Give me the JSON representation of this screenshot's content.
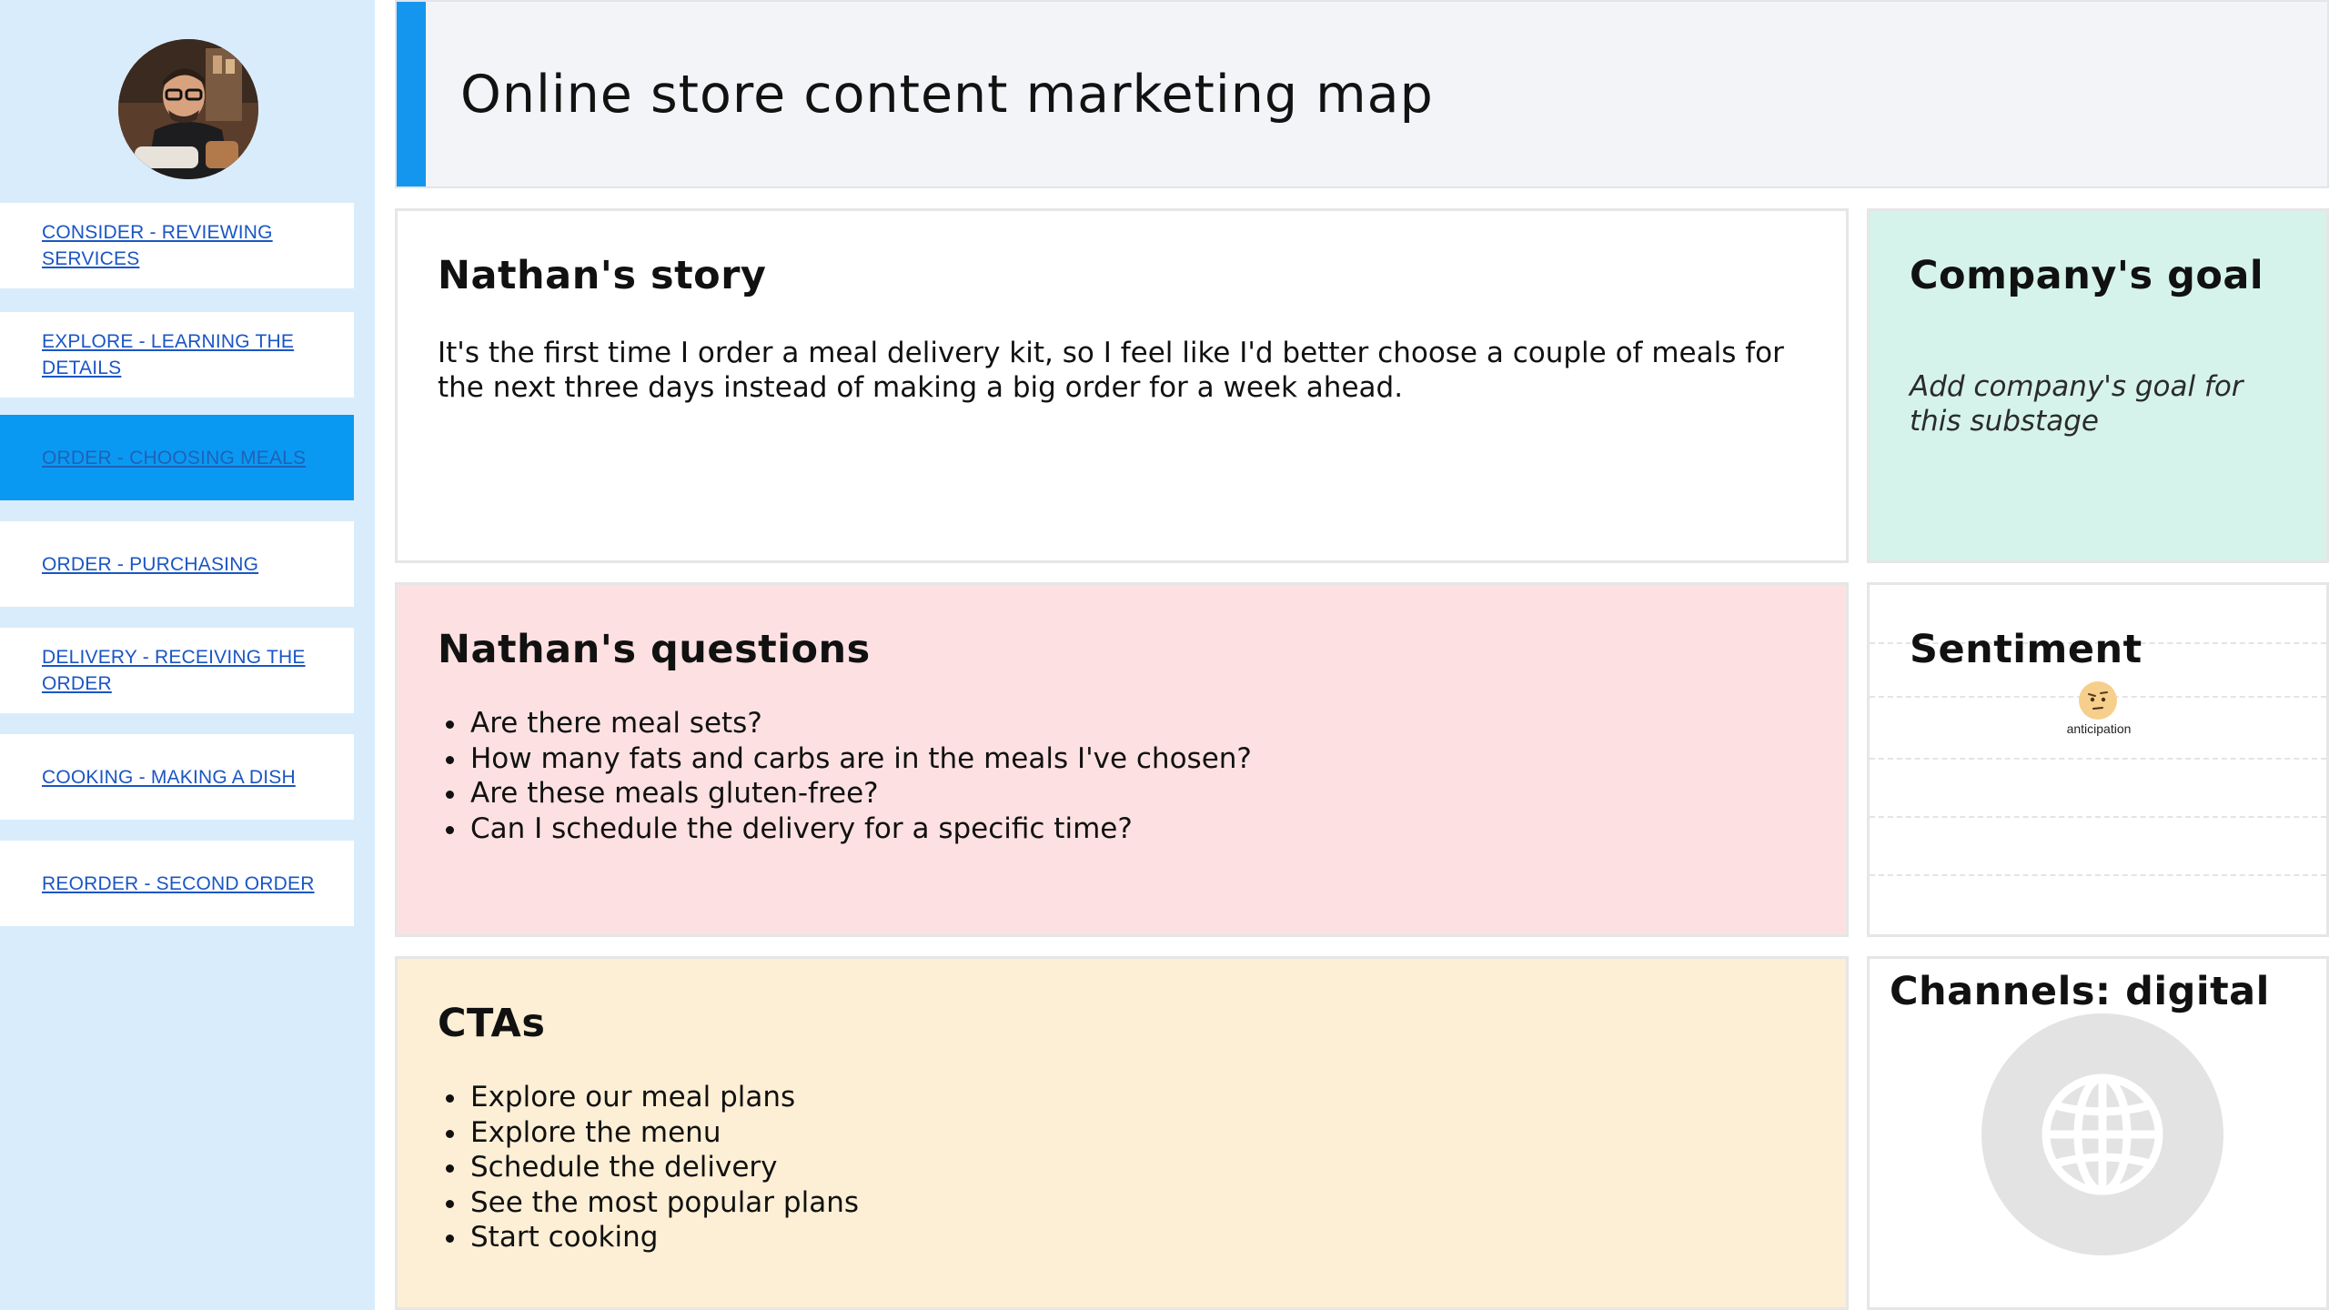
{
  "sidebar": {
    "items": [
      {
        "label": "CONSIDER - REVIEWING SERVICES",
        "active": false
      },
      {
        "label": "EXPLORE - LEARNING THE DETAILS",
        "active": false
      },
      {
        "label": "ORDER - CHOOSING MEALS",
        "active": true
      },
      {
        "label": "ORDER - PURCHASING",
        "active": false
      },
      {
        "label": "DELIVERY - RECEIVING THE ORDER",
        "active": false
      },
      {
        "label": "COOKING - MAKING A DISH",
        "active": false
      },
      {
        "label": "REORDER - SECOND ORDER",
        "active": false
      }
    ]
  },
  "header": {
    "title": "Online store content marketing map"
  },
  "story": {
    "title": "Nathan's story",
    "text": "It's the first time I order a meal delivery kit, so I feel like I'd better choose a couple of meals for the next three days instead of making a big order for a week ahead."
  },
  "goal": {
    "title": "Company's goal",
    "placeholder": "Add company's goal for this substage"
  },
  "questions": {
    "title": "Nathan's questions",
    "items": [
      "Are there meal sets?",
      "How many fats and carbs are in the meals I've chosen?",
      "Are these meals gluten-free?",
      "Can I schedule the delivery for a specific time?"
    ]
  },
  "sentiment": {
    "title": "Sentiment",
    "label": "anticipation",
    "icon": "anticipation-face-icon"
  },
  "ctas": {
    "title": "CTAs",
    "items": [
      "Explore our meal plans",
      "Explore the menu",
      "Schedule the delivery",
      "See the most popular plans",
      "Start cooking"
    ]
  },
  "channels": {
    "title": "Channels: digital",
    "icon": "globe-icon"
  },
  "colors": {
    "sidebar_bg": "#d9ecfb",
    "active_item": "#0a99f2",
    "header_accent": "#1596ee",
    "goal_bg": "#d5f3ea",
    "questions_bg": "#fde1e2",
    "ctas_bg": "#fdefd5"
  }
}
